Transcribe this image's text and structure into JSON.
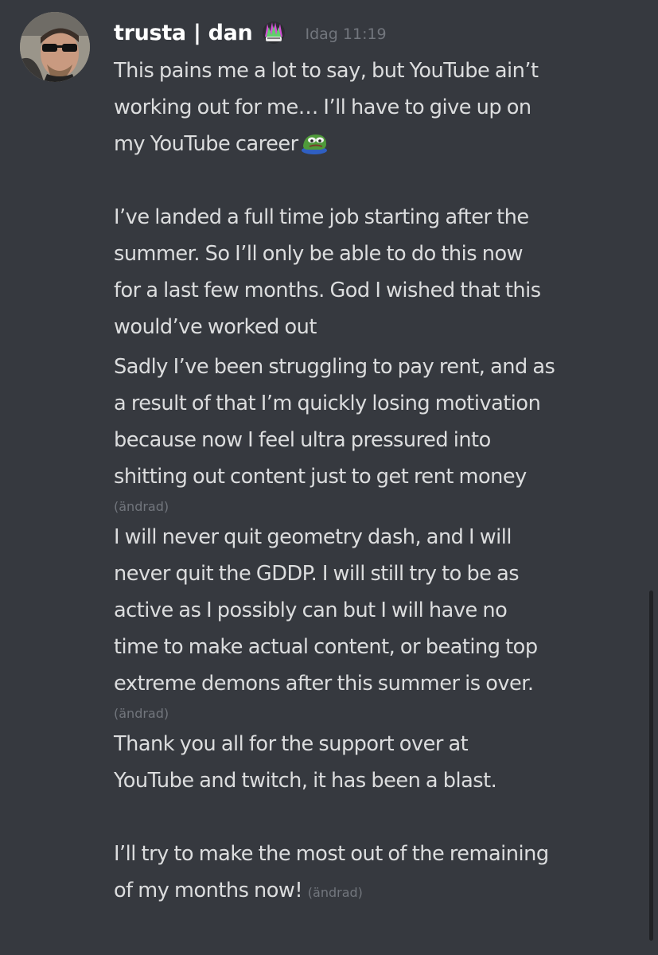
{
  "message": {
    "username": "trusta | dan",
    "badge_icon": "hydra-badge-icon",
    "timestamp": "Idag 11:19",
    "edited_label": "(ändrad)",
    "blocks": [
      {
        "lines": [
          "This pains me a lot to say, but YouTube ain’t",
          "working out for me… I’ll have to give up on",
          "my YouTube career"
        ],
        "emoji": "pepe-sad-emoji"
      },
      {
        "lines": [
          "I’ve landed a full time job starting after the",
          "summer. So I’ll only be able to do this now",
          "for a last few months. God I wished that this",
          "would’ve worked out"
        ]
      },
      {
        "lines": [
          "Sadly I’ve been struggling to pay rent, and as",
          "a result of that I’m quickly losing motivation",
          "because now I feel ultra pressured into",
          "shitting out content just to get rent money"
        ]
      },
      {
        "lines": [
          "I will never quit geometry dash, and I will",
          "never quit the GDDP. I will still try to be as",
          "active as I possibly can but I will have no",
          "time to make actual content, or beating top",
          "extreme demons after this summer is over."
        ]
      },
      {
        "lines": [
          "Thank you all for the support over at",
          "YouTube and twitch, it has been a blast."
        ]
      },
      {
        "lines": [
          "I’ll try to make the most out of the remaining",
          "of my months now!"
        ]
      }
    ]
  }
}
